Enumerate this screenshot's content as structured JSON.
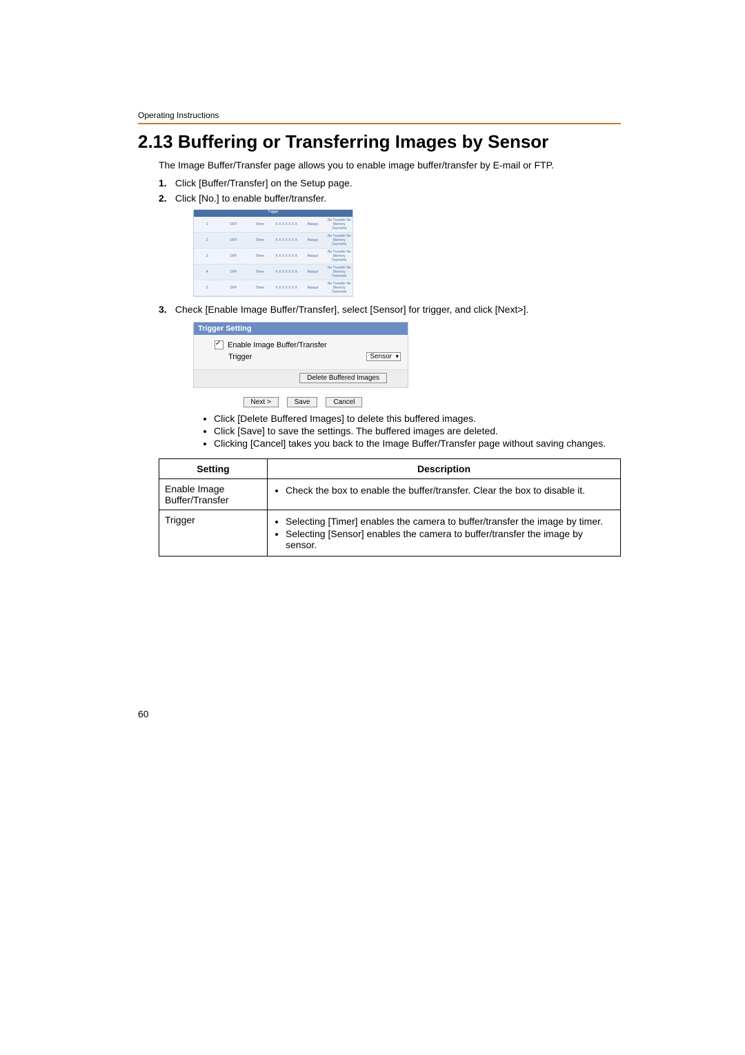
{
  "header": {
    "label": "Operating Instructions"
  },
  "title": "2.13  Buffering or Transferring Images by Sensor",
  "intro": "The Image Buffer/Transfer page allows you to enable image buffer/transfer by E-mail or FTP.",
  "steps": [
    {
      "num": "1.",
      "text": "Click [Buffer/Transfer] on the Setup page."
    },
    {
      "num": "2.",
      "text": "Click [No.] to enable buffer/transfer."
    },
    {
      "num": "3.",
      "text": "Check [Enable Image Buffer/Transfer], select [Sensor] for trigger, and click [Next>]."
    }
  ],
  "trigger_table": {
    "title": "Trigger",
    "rows": [
      {
        "no": "1",
        "status": "OFF",
        "trigger": "Timer",
        "days": "X X X X X X X",
        "active": "Always",
        "method": "No Transfer No Memory Overwrite",
        "notify": "-",
        "dest": "-"
      },
      {
        "no": "2",
        "status": "OFF",
        "trigger": "Timer",
        "days": "X X X X X X X",
        "active": "Always",
        "method": "No Transfer No Memory Overwrite",
        "notify": "-",
        "dest": "-"
      },
      {
        "no": "3",
        "status": "OFF",
        "trigger": "Timer",
        "days": "X X X X X X X",
        "active": "Always",
        "method": "No Transfer No Memory Overwrite",
        "notify": "-",
        "dest": "-"
      },
      {
        "no": "4",
        "status": "OFF",
        "trigger": "Timer",
        "days": "X X X X X X X",
        "active": "Always",
        "method": "No Transfer No Memory Overwrite",
        "notify": "-",
        "dest": "-"
      },
      {
        "no": "5",
        "status": "OFF",
        "trigger": "Timer",
        "days": "X X X X X X X",
        "active": "Always",
        "method": "No Transfer No Memory Overwrite",
        "notify": "-",
        "dest": "-"
      }
    ]
  },
  "trigger_setting": {
    "header": "Trigger Setting",
    "enable_label": "Enable Image Buffer/Transfer",
    "trigger_label": "Trigger",
    "trigger_value": "Sensor",
    "delete_btn": "Delete Buffered Images",
    "next_btn": "Next >",
    "save_btn": "Save",
    "cancel_btn": "Cancel"
  },
  "bullets": [
    "Click [Delete Buffered Images] to delete this buffered images.",
    "Click [Save] to save the settings. The buffered images are deleted.",
    "Clicking [Cancel] takes you back to the Image Buffer/Transfer page without saving changes."
  ],
  "settings_table": {
    "head_setting": "Setting",
    "head_description": "Description",
    "rows": [
      {
        "setting": "Enable Image Buffer/Transfer",
        "desc": [
          "Check the box to enable the buffer/transfer. Clear the box to disable it."
        ]
      },
      {
        "setting": "Trigger",
        "desc": [
          "Selecting [Timer] enables the camera to buffer/transfer the image by timer.",
          "Selecting [Sensor] enables the camera to buffer/transfer the image by sensor."
        ]
      }
    ]
  },
  "page_number": "60"
}
